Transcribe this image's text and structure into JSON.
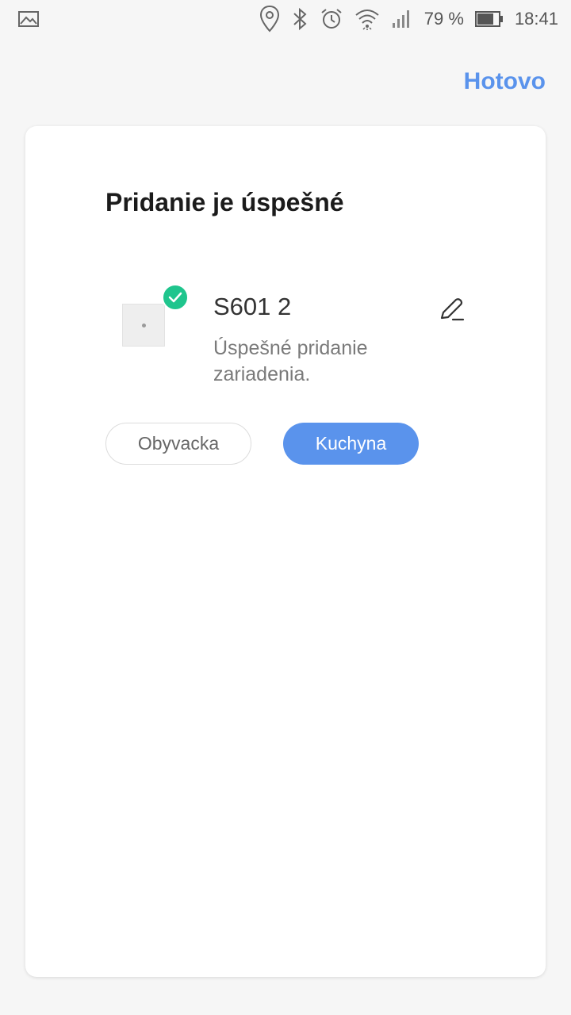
{
  "status_bar": {
    "battery_percent": "79 %",
    "time": "18:41",
    "icons": [
      "gallery-icon",
      "location-icon",
      "bluetooth-icon",
      "alarm-icon",
      "wifi-icon",
      "signal-icon",
      "battery-icon"
    ]
  },
  "header": {
    "done_label": "Hotovo",
    "accent_color": "#5a93ec"
  },
  "card": {
    "title": "Pridanie je úspešné",
    "device": {
      "name": "S601 2",
      "status": "Úspešné pridanie zariadenia.",
      "badge_color": "#1fc58d"
    },
    "rooms": [
      {
        "label": "Obyvacka",
        "selected": false
      },
      {
        "label": "Kuchyna",
        "selected": true
      }
    ]
  }
}
